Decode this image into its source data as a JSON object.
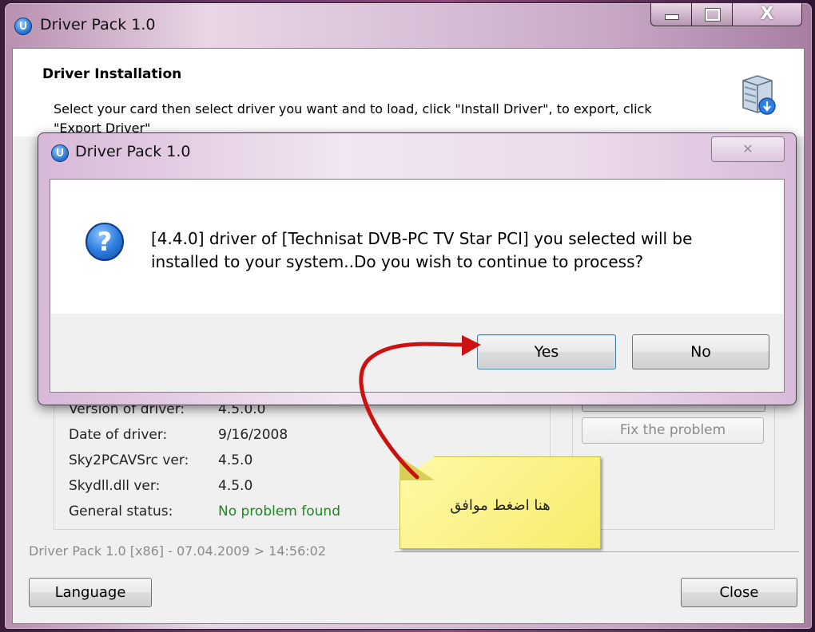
{
  "main_window": {
    "title": "Driver Pack 1.0",
    "header_title": "Driver Installation",
    "header_description": "Select your card then select driver you want and to load, click \"Install Driver\", to export, click \"Export Driver\""
  },
  "info": {
    "rows": [
      {
        "label": "Version of driver:",
        "value": "4.5.0.0"
      },
      {
        "label": "Date of driver:",
        "value": "9/16/2008"
      },
      {
        "label": "Sky2PCAVSrc ver:",
        "value": "4.5.0"
      },
      {
        "label": "Skydll.dll ver:",
        "value": "4.5.0"
      },
      {
        "label": "General status:",
        "value": "No problem found"
      }
    ],
    "fix_button": "Fix the problem",
    "status_color": "#1a8a1a"
  },
  "status_line": "Driver Pack 1.0 [x86] - 07.04.2009 > 14:56:02",
  "buttons": {
    "language": "Language",
    "close": "Close"
  },
  "dialog": {
    "title": "Driver Pack 1.0",
    "close_glyph": "✕",
    "question_glyph": "?",
    "message": "[4.4.0] driver of [Technisat DVB-PC TV Star PCI] you selected will be installed to your system..Do you wish to continue to process?",
    "yes": "Yes",
    "no": "No"
  },
  "annotation": {
    "text": "هنا اضغط موافق",
    "arrow_color": "#cc1111"
  },
  "caption_buttons": {
    "close_glyph": "X"
  }
}
